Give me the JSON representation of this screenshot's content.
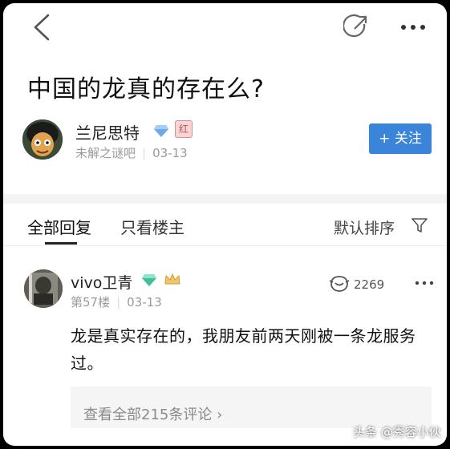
{
  "post": {
    "title": "中国的龙真的存在么?"
  },
  "author": {
    "name": "兰尼思特",
    "level_badge": "红",
    "source": "未解之谜吧",
    "date": "03-13",
    "follow_label": "+ 关注"
  },
  "tabs": {
    "all_replies": "全部回复",
    "only_owner": "只看楼主",
    "sort_label": "默认排序"
  },
  "comment": {
    "username": "vivo卫青",
    "floor": "第57楼",
    "date": "03-13",
    "like_count": "2269",
    "text": "龙是真实存在的，我朋友前两天刚被一条龙服务过。",
    "view_all": "查看全部215条评论 ›"
  },
  "watermark": "头条 @秀容小伙",
  "colors": {
    "accent_blue": "#3a84d9"
  }
}
